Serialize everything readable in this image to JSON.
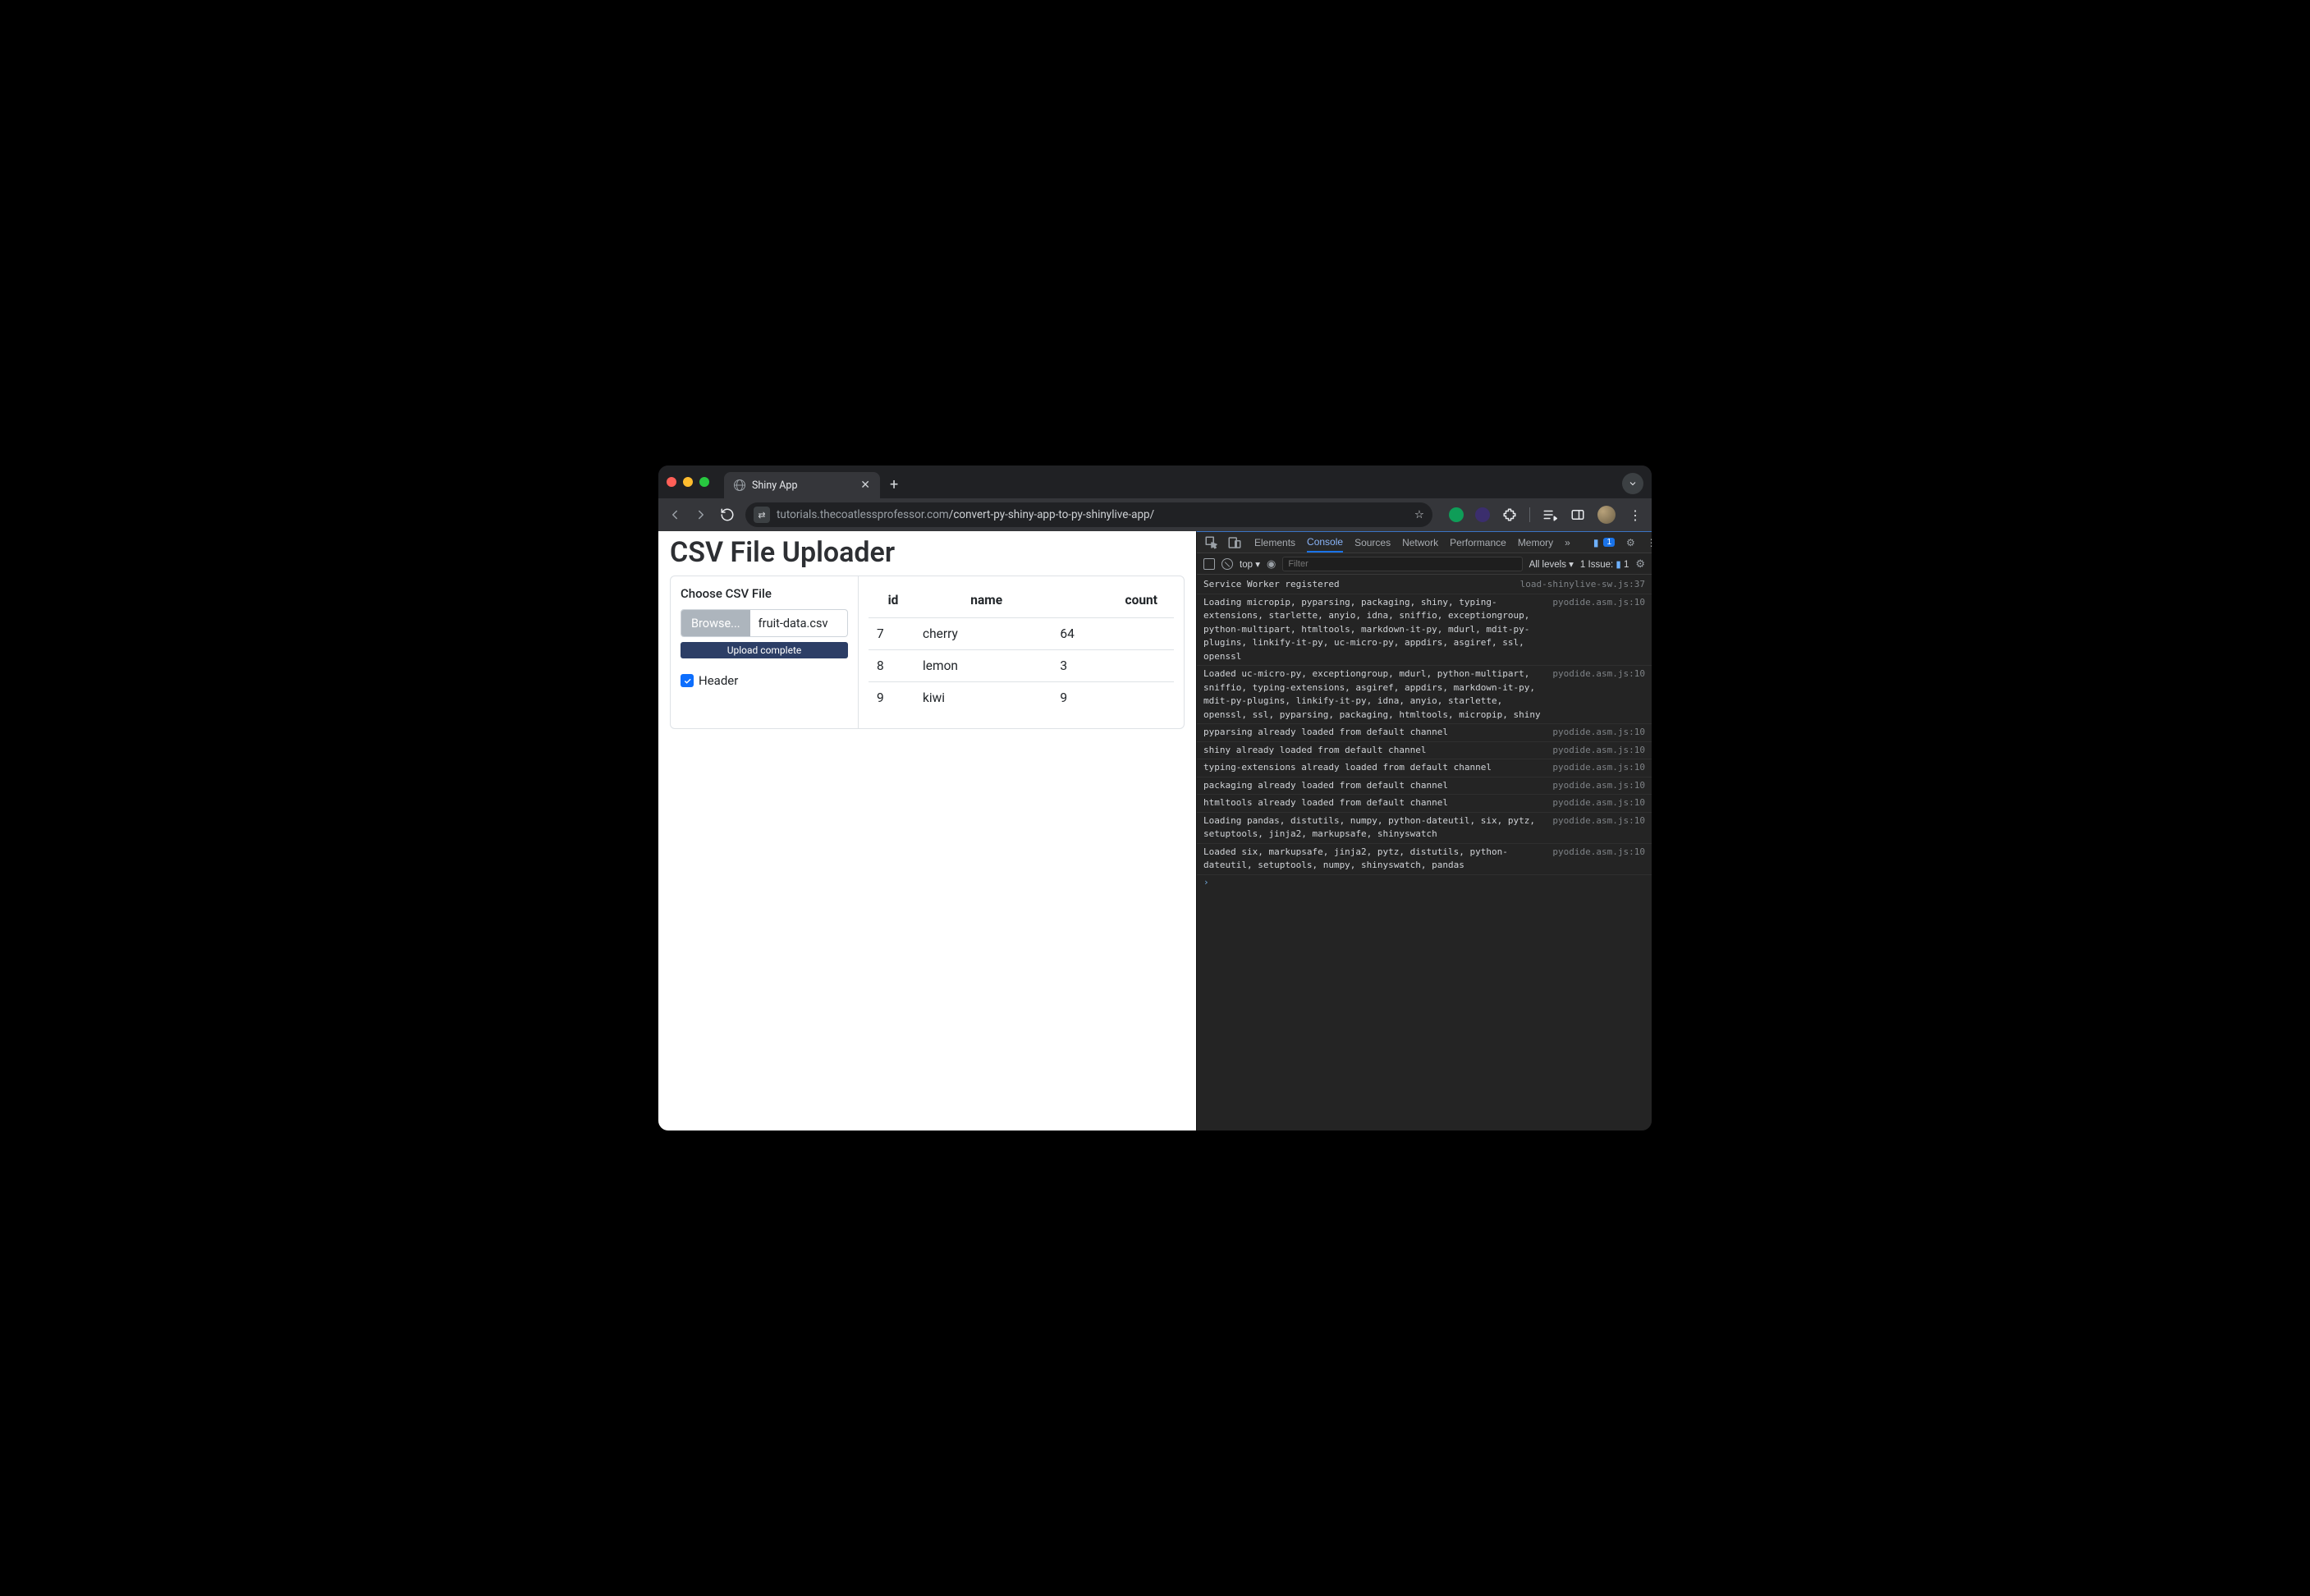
{
  "browser": {
    "tab_title": "Shiny App",
    "url_dim_prefix": "tutorials.thecoatlessprofessor.com",
    "url_path": "/convert-py-shiny-app-to-py-shinylive-app/",
    "new_tab_glyph": "+",
    "tab_close_glyph": "✕",
    "star_glyph": "☆",
    "dots_glyph": "⋮"
  },
  "app": {
    "title": "CSV File Uploader",
    "sidebar": {
      "label": "Choose CSV File",
      "browse_label": "Browse...",
      "filename": "fruit-data.csv",
      "progress_text": "Upload complete",
      "header_checkbox_label": "Header",
      "header_checked": true
    },
    "table": {
      "columns": [
        "id",
        "name",
        "count"
      ],
      "rows": [
        {
          "id": "7",
          "name": "cherry",
          "count": "64"
        },
        {
          "id": "8",
          "name": "lemon",
          "count": "3"
        },
        {
          "id": "9",
          "name": "kiwi",
          "count": "9"
        }
      ]
    }
  },
  "devtools": {
    "tabs": [
      "Elements",
      "Console",
      "Sources",
      "Network",
      "Performance",
      "Memory"
    ],
    "active_tab": "Console",
    "overflow_glyph": "»",
    "msg_badge": "1",
    "context": "top",
    "filter_placeholder": "Filter",
    "levels_label": "All levels",
    "issues_label": "1 Issue:",
    "issues_count": "1",
    "logs": [
      {
        "msg": "Service Worker registered",
        "src": "load-shinylive-sw.js:37"
      },
      {
        "msg": "Loading micropip, pyparsing, packaging, shiny, typing-extensions, starlette, anyio, idna, sniffio, exceptiongroup, python-multipart, htmltools, markdown-it-py, mdurl, mdit-py-plugins, linkify-it-py, uc-micro-py, appdirs, asgiref, ssl, openssl",
        "src": "pyodide.asm.js:10"
      },
      {
        "msg": "Loaded uc-micro-py, exceptiongroup, mdurl, python-multipart, sniffio, typing-extensions, asgiref, appdirs, markdown-it-py, mdit-py-plugins, linkify-it-py, idna, anyio, starlette, openssl, ssl, pyparsing, packaging, htmltools, micropip, shiny",
        "src": "pyodide.asm.js:10"
      },
      {
        "msg": "pyparsing already loaded from default channel",
        "src": "pyodide.asm.js:10"
      },
      {
        "msg": "shiny already loaded from default channel",
        "src": "pyodide.asm.js:10"
      },
      {
        "msg": "typing-extensions already loaded from default channel",
        "src": "pyodide.asm.js:10"
      },
      {
        "msg": "packaging already loaded from default channel",
        "src": "pyodide.asm.js:10"
      },
      {
        "msg": "htmltools already loaded from default channel",
        "src": "pyodide.asm.js:10"
      },
      {
        "msg": "Loading pandas, distutils, numpy, python-dateutil, six, pytz, setuptools, jinja2, markupsafe, shinyswatch",
        "src": "pyodide.asm.js:10"
      },
      {
        "msg": "Loaded six, markupsafe, jinja2, pytz, distutils, python-dateutil, setuptools, numpy, shinyswatch, pandas",
        "src": "pyodide.asm.js:10"
      }
    ],
    "prompt_glyph": "›"
  }
}
